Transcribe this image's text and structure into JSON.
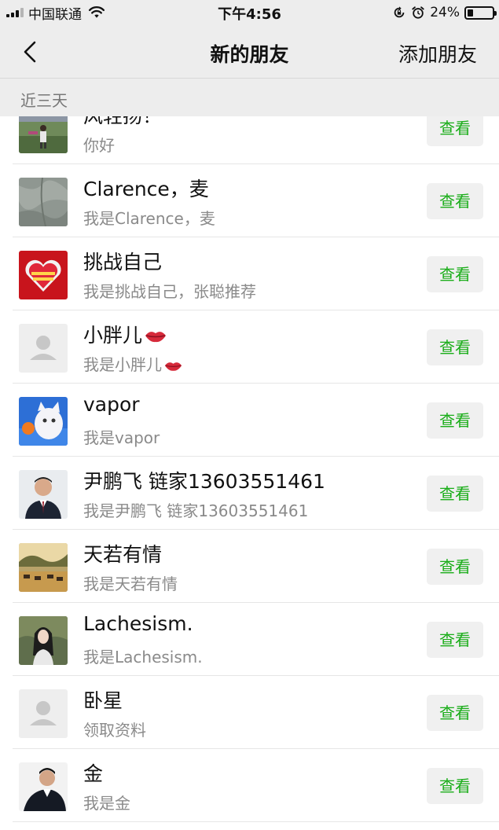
{
  "status_bar": {
    "carrier": "中国联通",
    "time": "下午4:56",
    "battery": "24%"
  },
  "nav": {
    "title": "新的朋友",
    "action": "添加朋友"
  },
  "section": {
    "label": "近三天"
  },
  "view_label": "查看",
  "items": [
    {
      "name": "风轻扬！",
      "message": "你好"
    },
    {
      "name": "Clarence，麦",
      "message": "我是Clarence，麦"
    },
    {
      "name": "挑战自己",
      "message": "我是挑战自己，张聪推荐"
    },
    {
      "name": "小胖儿",
      "message": "我是小胖儿"
    },
    {
      "name": "vapor",
      "message": "我是vapor"
    },
    {
      "name": "尹鹏飞 链家13603551461",
      "message": "我是尹鹏飞 链家13603551461"
    },
    {
      "name": "天若有情",
      "message": "我是天若有情"
    },
    {
      "name": "Lachesism.",
      "message": "我是Lachesism."
    },
    {
      "name": "卧星",
      "message": "领取资料"
    },
    {
      "name": "金",
      "message": "我是金"
    }
  ],
  "colors": {
    "accent": "#1aad19",
    "bar_bg": "#ededed"
  }
}
